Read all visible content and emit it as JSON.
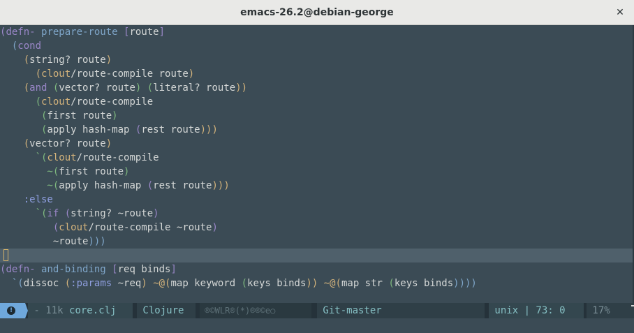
{
  "window": {
    "title": "emacs-26.2@debian-george",
    "close_glyph": "✕"
  },
  "code": {
    "l1": {
      "a": "(",
      "b": "defn-",
      "c": " prepare-route ",
      "d": "[",
      "e": "route",
      "f": "]"
    },
    "l2": {
      "a": "  (",
      "b": "cond"
    },
    "l3": {
      "a": "    (",
      "b": "string? route",
      "c": ")"
    },
    "l4": {
      "a": "      (",
      "b": "clout",
      "c": "/route-compile route",
      "d": ")"
    },
    "l5": {
      "a": "    (",
      "b": "and",
      "c": " (",
      "d": "vector? route",
      "e": ") (",
      "f": "literal? route",
      "g": "))"
    },
    "l6": {
      "a": "      (",
      "b": "clout",
      "c": "/route-compile"
    },
    "l7": {
      "a": "       (",
      "b": "first route",
      "c": ")"
    },
    "l8": {
      "a": "       (",
      "b": "apply hash-map ",
      "c": "(",
      "d": "rest route",
      "e": ")))"
    },
    "l9": {
      "a": "    (",
      "b": "vector? route",
      "c": ")"
    },
    "l10": {
      "a": "      `(",
      "b": "clout",
      "c": "/route-compile"
    },
    "l11": {
      "a": "        ~(",
      "b": "first route",
      "c": ")"
    },
    "l12": {
      "a": "        ~(",
      "b": "apply hash-map ",
      "c": "(",
      "d": "rest route",
      "e": ")))"
    },
    "l13": {
      "a": "    :else"
    },
    "l14": {
      "a": "      `(",
      "b": "if",
      "c": " (",
      "d": "string? ~route",
      "e": ")"
    },
    "l15": {
      "a": "         (",
      "b": "clout",
      "c": "/route-compile ~route",
      "d": ")"
    },
    "l16": {
      "a": "         ~route",
      "b": ")))"
    },
    "l18": {
      "a": "(",
      "b": "defn-",
      "c": " and-binding ",
      "d": "[",
      "e": "req binds",
      "f": "]"
    },
    "l19": {
      "a": "  `(",
      "b": "dissoc ",
      "c": "(",
      "d": ":params",
      "e": " ~req",
      "f": ") ~@(",
      "g": "map keyword ",
      "h": "(",
      "i": "keys binds",
      "j": ")) ~@(",
      "k": "map str ",
      "l": "(",
      "m": "keys binds",
      "n": "))))"
    }
  },
  "modeline": {
    "info_glyph": "!",
    "file_state": " - 11k ",
    "file_name": "core.clj",
    "major_mode": " Clojure",
    "flags": " ®©WLR®(*)®®©e○",
    "git": " Git-master",
    "encoding_pos": " unix | 73: 0",
    "percent": " 17%"
  },
  "colors": {
    "background": "#3b4b55",
    "cursor_line": "#4f606b",
    "keyword": "#9a87c8",
    "function": "#7fa6c9",
    "namespace": "#d2b27b",
    "modeline_accent": "#6fa8dc"
  }
}
